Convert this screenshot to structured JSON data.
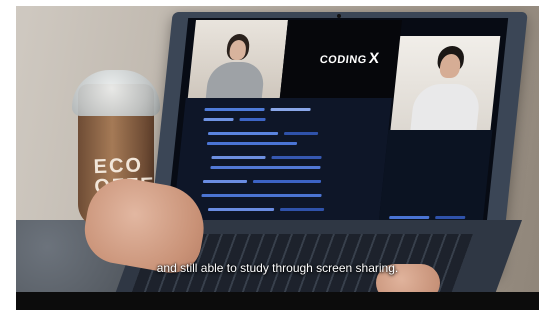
{
  "scene": {
    "subtitle": "and still able to study through screen sharing.",
    "screen_brand": "CODING",
    "screen_brand_mark": "X",
    "cup_logo_lines": [
      "ECO",
      "OFFE"
    ]
  },
  "colors": {
    "bottom_bar": "#0c0c0c",
    "editor_background": "#0e1628",
    "laptop_lid": "#3b4656"
  }
}
